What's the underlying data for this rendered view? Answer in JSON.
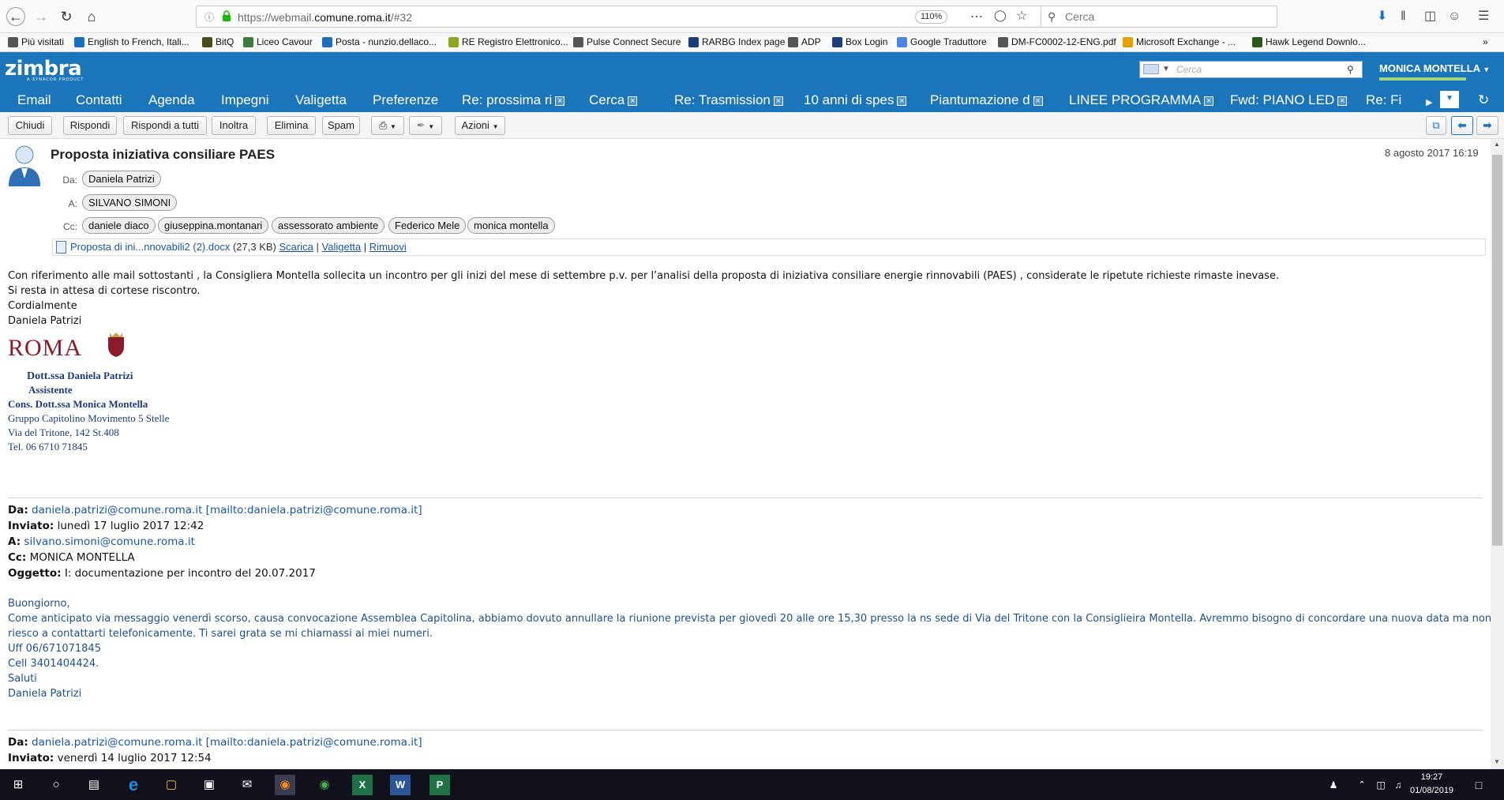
{
  "browser": {
    "url_prefix": "https://webmail.",
    "url_domain": "comune.roma.it",
    "url_suffix": "/#32",
    "zoom": "110%",
    "search_placeholder": "Cerca"
  },
  "bookmarks": [
    {
      "label": "Più visitati",
      "color": "#555"
    },
    {
      "label": "English to French, Itali...",
      "color": "#1b6fc2"
    },
    {
      "label": "BitQ",
      "color": "#4a4a1a"
    },
    {
      "label": "Liceo Cavour",
      "color": "#3a7a3a"
    },
    {
      "label": "Posta - nunzio.dellaco...",
      "color": "#1b6fc2"
    },
    {
      "label": "RE Registro Elettronico...",
      "color": "#8aa81b"
    },
    {
      "label": "Pulse Connect Secure",
      "color": "#555"
    },
    {
      "label": "RARBG Index page",
      "color": "#1b3f7a"
    },
    {
      "label": "ADP",
      "color": "#555"
    },
    {
      "label": "Box Login",
      "color": "#1b3f7a"
    },
    {
      "label": "Google Traduttore",
      "color": "#4a86e8"
    },
    {
      "label": "DM-FC0002-12-ENG.pdf",
      "color": "#555"
    },
    {
      "label": "Microsoft Exchange - ...",
      "color": "#e8a000"
    },
    {
      "label": "Hawk Legend Downlo...",
      "color": "#2a5a1a"
    }
  ],
  "zimbra": {
    "logo": "zimbra",
    "logo_sub": "A SYNACOR PRODUCT",
    "search_placeholder": "Cerca",
    "user": "MONICA MONTELLA"
  },
  "tabs": [
    "Email",
    "Contatti",
    "Agenda",
    "Impegni",
    "Valigetta",
    "Preferenze",
    "Re: prossima ri",
    "Cerca",
    "Re: Trasmission",
    "10 anni di spes",
    "Piantumazione d",
    "LINEE PROGRAMMA",
    "Fwd: PIANO LED",
    "Re: Fi"
  ],
  "toolbar": {
    "close": "Chiudi",
    "reply": "Rispondi",
    "reply_all": "Rispondi a tutti",
    "forward": "Inoltra",
    "delete": "Elimina",
    "spam": "Spam",
    "actions": "Azioni"
  },
  "message": {
    "subject": "Proposta iniziativa consiliare PAES",
    "date": "8 agosto 2017 16:19",
    "from_label": "Da:",
    "from": "Daniela Patrizi",
    "to_label": "A:",
    "to": "SILVANO SIMONI",
    "cc_label": "Cc:",
    "cc": [
      "daniele diaco",
      "giuseppina.montanari",
      "assessorato ambiente",
      "Federico Mele",
      "monica montella"
    ],
    "attachment": {
      "name": "Proposta di ini...nnovabili2 (2).docx",
      "size": "(27,3 KB)",
      "download": "Scarica",
      "briefcase": "Valigetta",
      "remove": "Rimuovi",
      "sep": "|"
    },
    "body": [
      "Con riferimento alle mail sottostanti , la Consigliera Montella sollecita  un incontro  per gli inizi del mese di settembre p.v. per l’analisi della proposta di iniziativa consiliare energie rinnovabili (PAES) , considerate le ripetute richieste rimaste inevase.",
      "Si resta in attesa di cortese riscontro.",
      "Cordialmente",
      "Daniela Patrizi"
    ],
    "signature": {
      "roma": "ROMA",
      "title_prefix": "Dott.ssa",
      "name": "Daniela Patrizi",
      "role": "Assistente",
      "cons": "Cons. Dott.ssa Monica Montella",
      "group": "Gruppo Capitolino Movimento 5 Stelle",
      "address": "Via del Tritone, 142 St.408",
      "tel": "Tel. 06 6710 71845"
    },
    "quoted1": {
      "da_label": "Da:",
      "da_email": "daniela.patrizi@comune.roma.it",
      "da_mailto": "[mailto:daniela.patrizi@comune.roma.it]",
      "sent_label": "Inviato:",
      "sent": "lunedì 17 luglio 2017 12:42",
      "to_label": "A:",
      "to": "silvano.simoni@comune.roma.it",
      "cc_label": "Cc:",
      "cc": "MONICA MONTELLA",
      "subj_label": "Oggetto:",
      "subj": "I: documentazione per incontro del 20.07.2017",
      "body": [
        "Buongiorno,",
        "Come anticipato via messaggio venerdì scorso, causa convocazione Assemblea Capitolina, abbiamo dovuto annullare la riunione prevista per giovedì 20 alle ore 15,30 presso la ns sede di Via del Tritone con la Consiglieira Montella. Avremmo bisogno di concordare una nuova data ma non",
        "riesco a contattarti telefonicamente. Ti sarei grata se mi chiamassi ai miei numeri.",
        "Uff 06/671071845",
        "Cell 3401404424.",
        "Saluti",
        "Daniela Patrizi"
      ]
    },
    "quoted2": {
      "da_label": "Da:",
      "da_email": "daniela.patrizi@comune.roma.it",
      "da_mailto": "[mailto:daniela.patrizi@comune.roma.it]",
      "sent_label": "Inviato:",
      "sent": "venerdì 14 luglio 2017 12:54"
    }
  },
  "taskbar": {
    "time": "19:27",
    "date": "01/08/2019"
  }
}
